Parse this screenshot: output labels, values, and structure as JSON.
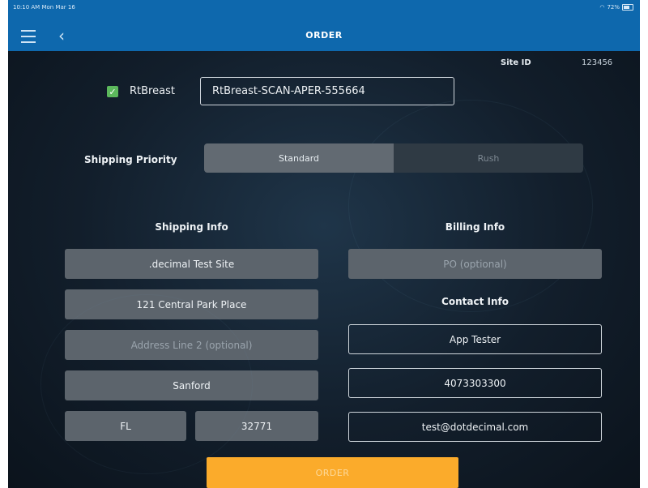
{
  "status_bar": {
    "time": "10:10 AM  Mon Mar 16",
    "battery": "72%"
  },
  "header": {
    "title": "ORDER"
  },
  "site": {
    "label": "Site ID",
    "value": "123456"
  },
  "rtbreast": {
    "label": "RtBreast",
    "value": "RtBreast-SCAN-APER-555664",
    "checked": true
  },
  "shipping_priority": {
    "label": "Shipping Priority",
    "options": [
      "Standard",
      "Rush"
    ],
    "selected": "Standard"
  },
  "shipping": {
    "title": "Shipping Info",
    "site_name": ".decimal Test Site",
    "address1": "121 Central Park Place",
    "address2_placeholder": "Address Line 2 (optional)",
    "city": "Sanford",
    "state": "FL",
    "zip": "32771"
  },
  "billing": {
    "title": "Billing Info",
    "po_placeholder": "PO (optional)"
  },
  "contact": {
    "title": "Contact Info",
    "name": "App Tester",
    "phone": "4073303300",
    "email": "test@dotdecimal.com"
  },
  "order_button": {
    "label": "ORDER"
  },
  "colors": {
    "nav_blue": "#0e68ad",
    "accent_orange": "#fbab2b",
    "check_green": "#5cb85c"
  }
}
